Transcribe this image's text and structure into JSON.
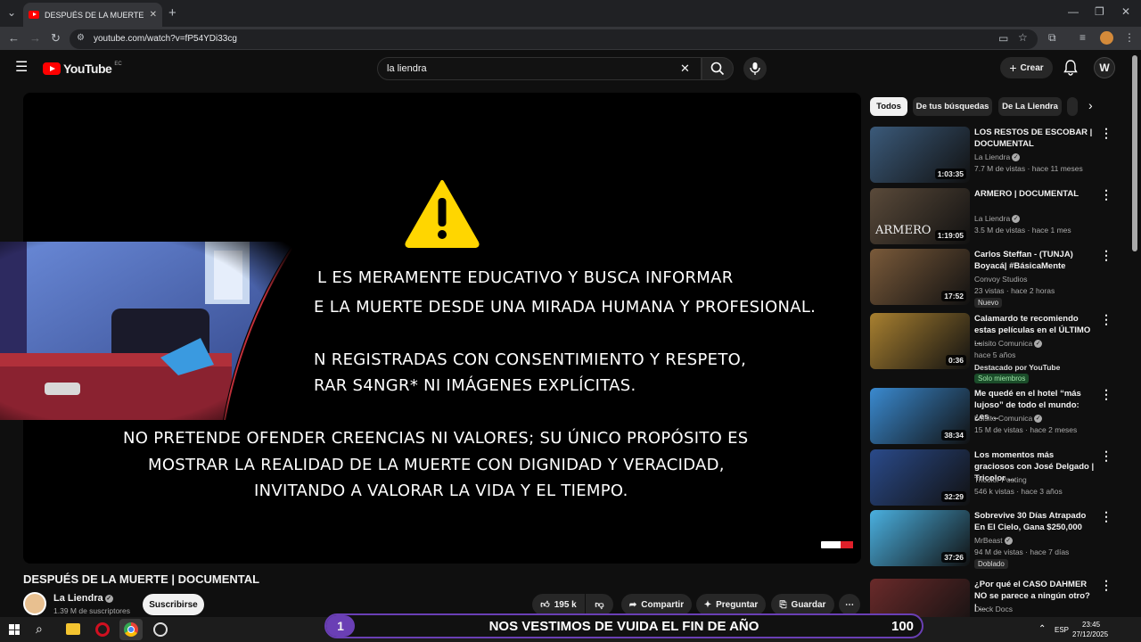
{
  "browser": {
    "tab_title": "DESPUÉS DE LA MUERTE | DOC",
    "url": "youtube.com/watch?v=fP54YDi33cg"
  },
  "youtube": {
    "logo": "YouTube",
    "region": "EC",
    "search_value": "la liendra",
    "create_label": "Crear",
    "account_initial": "W"
  },
  "video": {
    "lines": [
      "L ES MERAMENTE EDUCATIVO Y BUSCA INFORMAR",
      "E LA MUERTE DESDE UNA MIRADA HUMANA Y PROFESIONAL.",
      "N REGISTRADAS CON CONSENTIMIENTO Y RESPETO,",
      "RAR S4NGR* NI IMÁGENES EXPLÍCITAS.",
      "NO PRETENDE OFENDER CREENCIAS NI VALORES; SU ÚNICO PROPÓSITO ES",
      "MOSTRAR LA REALIDAD DE LA MUERTE CON DIGNIDAD Y VERACIDAD,",
      "INVITANDO A VALORAR LA VIDA Y EL TIEMPO."
    ],
    "title": "DESPUÉS DE LA MUERTE | DOCUMENTAL",
    "channel": "La Liendra",
    "subscribers": "1.39 M de suscriptores",
    "subscribe_label": "Suscribirse",
    "likes": "195 k",
    "share_label": "Compartir",
    "ask_label": "Preguntar",
    "save_label": "Guardar"
  },
  "chips": [
    "Todos",
    "De tus búsquedas",
    "De La Liendra"
  ],
  "recommendations": [
    {
      "title": "LOS RESTOS DE ESCOBAR | DOCUMENTAL",
      "channel": "La Liendra",
      "verified": true,
      "meta": "7.7 M de vistas · hace 11 meses",
      "duration": "1:03:35",
      "thumb_color": "#3b5a7a"
    },
    {
      "title": "ARMERO | DOCUMENTAL",
      "channel": "La Liendra",
      "verified": true,
      "meta": "3.5 M de vistas · hace 1 mes",
      "duration": "1:19:05",
      "thumb_color": "#5a4a3a",
      "thumb_text": "ARMERO"
    },
    {
      "title": "Carlos Steffan  - (TUNJA) Boyacá| #BásicaMente",
      "channel": "Convoy Studios",
      "verified": false,
      "meta": "23 vistas · hace 2 horas",
      "duration": "17:52",
      "badge": "Nuevo",
      "thumb_color": "#7a5a3a"
    },
    {
      "title": "Calamardo te recomiendo estas películas en el ÚLTIMO ...",
      "channel": "Luisito Comunica",
      "verified": true,
      "meta": "hace 5 años",
      "duration": "0:36",
      "extra": "Destacado por YouTube",
      "badge": "Solo miembros",
      "thumb_color": "#a88030"
    },
    {
      "title": "Me quedé en el hotel “más lujoso” de todo el mundo: ¿es ...",
      "channel": "Luisito Comunica",
      "verified": true,
      "meta": "15 M de vistas · hace 2 meses",
      "duration": "38:34",
      "thumb_color": "#3a8ad0"
    },
    {
      "title": "Los momentos más graciosos con José Delgado | Tricolor ...",
      "channel": "Tricolor Posting",
      "verified": false,
      "meta": "546 k vistas · hace 3 años",
      "duration": "32:29",
      "thumb_color": "#2a4a8a"
    },
    {
      "title": "Sobrevive 30 Días Atrapado En El Cielo, Gana $250,000",
      "channel": "MrBeast",
      "verified": true,
      "meta": "94 M de vistas · hace 7 días",
      "duration": "37:26",
      "badge": "Doblado",
      "thumb_color": "#4ab0e0"
    },
    {
      "title": "¿Por qué el CASO DAHMER NO se parece a ningún otro? | ...",
      "channel": "Dieck Docs",
      "verified": false,
      "meta": "",
      "duration": "",
      "thumb_color": "#6a2a2a"
    }
  ],
  "banner": {
    "number_left": "1",
    "text": "NOS VESTIMOS DE VUIDA EL FIN DE AÑO",
    "number_right": "100"
  },
  "taskbar": {
    "lang": "ESP",
    "time": "23:45",
    "date": "27/12/2025"
  },
  "colors": {
    "bg": "#0f0f0f",
    "warning": "#ffd600",
    "banner_purple": "#6a3fb5",
    "yt_red": "#ff0000"
  }
}
